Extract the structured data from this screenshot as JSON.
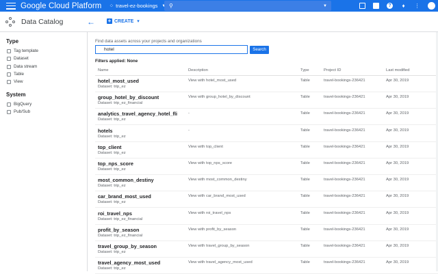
{
  "topbar": {
    "title": "Google Cloud Platform",
    "project": "travel-ez-bookings"
  },
  "subbar": {
    "title": "Data Catalog",
    "create_label": "CREATE"
  },
  "sidebar": {
    "type_heading": "Type",
    "type_items": [
      "Tag template",
      "Dataset",
      "Data stream",
      "Table",
      "View"
    ],
    "system_heading": "System",
    "system_items": [
      "BigQuery",
      "Pub/Sub"
    ]
  },
  "search": {
    "prompt": "Find data assets across your projects and organizations",
    "value": "hotel",
    "button": "Search",
    "filters": "Filters applied: None"
  },
  "table": {
    "headers": [
      "Name",
      "Description",
      "Type",
      "Project ID",
      "Last modified"
    ],
    "rows": [
      {
        "name": "hotel_most_used",
        "dataset": "Dataset: trip_ez",
        "description": "View with hotel_most_used",
        "type": "Table",
        "project": "travel-bookings-236421",
        "modified": "Apr 30, 2019"
      },
      {
        "name": "group_hotel_by_discount",
        "dataset": "Dataset: trip_ez_financial",
        "description": "View with group_hotel_by_discount",
        "type": "Table",
        "project": "travel-bookings-236421",
        "modified": "Apr 30, 2019"
      },
      {
        "name": "analytics_travel_agency_hotel_fli",
        "dataset": "Dataset: trip_ez",
        "description": "-",
        "type": "Table",
        "project": "travel-bookings-236421",
        "modified": "Apr 30, 2019"
      },
      {
        "name": "hotels",
        "dataset": "Dataset: trip_ez",
        "description": "-",
        "type": "Table",
        "project": "travel-bookings-236421",
        "modified": "Apr 30, 2019"
      },
      {
        "name": "top_client",
        "dataset": "Dataset: trip_ez",
        "description": "View with top_client",
        "type": "Table",
        "project": "travel-bookings-236421",
        "modified": "Apr 30, 2019"
      },
      {
        "name": "top_nps_score",
        "dataset": "Dataset: trip_ez",
        "description": "View with top_nps_score",
        "type": "Table",
        "project": "travel-bookings-236421",
        "modified": "Apr 30, 2019"
      },
      {
        "name": "most_common_destiny",
        "dataset": "Dataset: trip_ez",
        "description": "View with most_common_destiny",
        "type": "Table",
        "project": "travel-bookings-236421",
        "modified": "Apr 30, 2019"
      },
      {
        "name": "car_brand_most_used",
        "dataset": "Dataset: trip_ez",
        "description": "View with car_brand_most_used",
        "type": "Table",
        "project": "travel-bookings-236421",
        "modified": "Apr 30, 2019"
      },
      {
        "name": "roi_travel_nps",
        "dataset": "Dataset: trip_ez_financial",
        "description": "View with roi_travel_nps",
        "type": "Table",
        "project": "travel-bookings-236421",
        "modified": "Apr 30, 2019"
      },
      {
        "name": "profit_by_season",
        "dataset": "Dataset: trip_ez_financial",
        "description": "View with profit_by_season",
        "type": "Table",
        "project": "travel-bookings-236421",
        "modified": "Apr 30, 2019"
      },
      {
        "name": "travel_group_by_season",
        "dataset": "Dataset: trip_ez",
        "description": "View with travel_group_by_season",
        "type": "Table",
        "project": "travel-bookings-236421",
        "modified": "Apr 30, 2019"
      },
      {
        "name": "travel_agency_most_used",
        "dataset": "Dataset: trip_ez",
        "description": "View with travel_agency_most_used",
        "type": "Table",
        "project": "travel-bookings-236421",
        "modified": "Apr 30, 2019"
      }
    ]
  },
  "colors": {
    "brand_blue": "#1a73e8"
  },
  "icons": [
    "menu-icon",
    "project-dots-icon",
    "search-icon",
    "console-icon",
    "support-icon",
    "help-icon",
    "notifications-icon",
    "more-vert-icon",
    "account-avatar",
    "data-catalog-logo",
    "back-arrow-icon",
    "add-icon"
  ]
}
